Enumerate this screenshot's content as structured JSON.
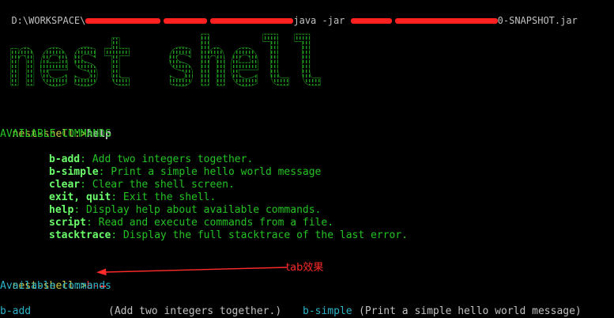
{
  "terminal": {
    "command_line": {
      "drive": "D:\\WORKSPACE\\",
      "middle_visible": "java -jar",
      "tail": "0-SNAPSHOT.jar"
    },
    "banner_text": "nest shell",
    "help_section": {
      "prompt": "nest-shell:>",
      "input": "help",
      "heading": "AVAILABLE COMMANDS",
      "commands": [
        {
          "name": "b-add",
          "desc": ": Add two integers together."
        },
        {
          "name": "b-simple",
          "desc": ": Print a simple hello world message"
        },
        {
          "name": "clear",
          "desc": ": Clear the shell screen."
        },
        {
          "name": "exit, quit",
          "desc": ": Exit the shell."
        },
        {
          "name": "help",
          "desc": ": Display help about available commands."
        },
        {
          "name": "script",
          "desc": ": Read and execute commands from a file."
        },
        {
          "name": "stacktrace",
          "desc": ": Display the full stacktrace of the last error."
        }
      ]
    },
    "tab_section": {
      "prompt": "nest-shell:>",
      "input": "b-",
      "heading": "Available commands",
      "completions": [
        {
          "name": "b-add",
          "desc": "(Add two integers together.)"
        },
        {
          "name": "b-simple",
          "desc": "(Print a simple hello world message)"
        }
      ]
    },
    "annotation": {
      "label": "tab效果",
      "color": "#ff2a2a"
    },
    "colors": {
      "background": "#000000",
      "text_green": "#24c324",
      "command_green": "#6cff6c",
      "prompt_yellow": "#c8c84a",
      "completion_cyan": "#2bb3c8",
      "annotation_red": "#ff2a2a"
    }
  }
}
